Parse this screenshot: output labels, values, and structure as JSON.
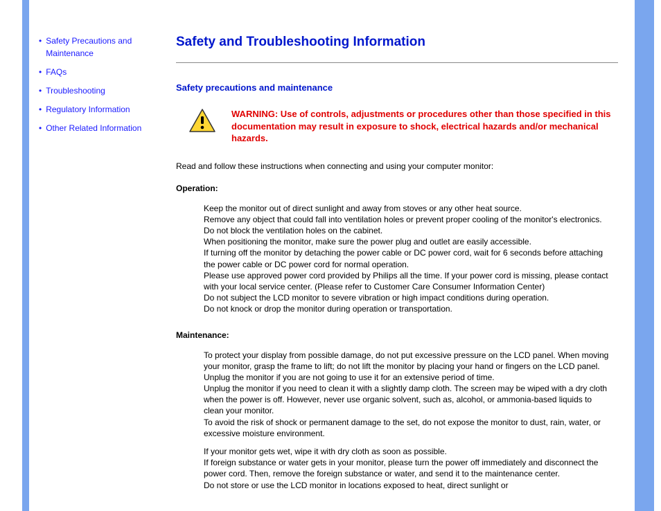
{
  "sidebar": {
    "items": [
      {
        "label": "Safety Precautions and Maintenance"
      },
      {
        "label": "FAQs"
      },
      {
        "label": "Troubleshooting"
      },
      {
        "label": "Regulatory Information"
      },
      {
        "label": "Other Related Information"
      }
    ]
  },
  "main": {
    "title": "Safety and Troubleshooting Information",
    "section_head": "Safety precautions and maintenance",
    "warning": "WARNING: Use of controls, adjustments or procedures other than those specified in this documentation may result in exposure to shock, electrical hazards and/or mechanical hazards.",
    "intro": "Read and follow these instructions when connecting and using your computer monitor:",
    "operation_head": "Operation:",
    "operation_paras": [
      "Keep the monitor out of direct sunlight and away from stoves or any other heat source.",
      "Remove any object that could fall into ventilation holes or prevent proper cooling of the monitor's electronics.",
      "Do not block the ventilation holes on the cabinet.",
      "When positioning the monitor, make sure the power plug and outlet are easily accessible.",
      "If turning off the monitor by detaching the power cable or DC power cord, wait for 6 seconds before attaching the power cable or DC power cord for normal operation.",
      "Please use approved power cord provided by Philips all the time. If your power cord is missing, please contact with your local service center. (Please refer to Customer Care Consumer Information Center)",
      "Do not subject the LCD monitor to severe vibration or high impact conditions during operation.",
      "Do not knock or drop the monitor during operation or transportation."
    ],
    "maintenance_head": "Maintenance:",
    "maintenance_paras": [
      "To protect your display from possible damage, do not put excessive pressure on the LCD panel. When moving your monitor, grasp the frame to lift; do not lift the monitor by placing your hand or fingers on the LCD panel.",
      "Unplug the monitor if you are not going to use it for an extensive period of time.",
      "Unplug the monitor if you need to clean it with a slightly damp cloth. The screen may be wiped with a dry cloth when the power is off. However, never use organic solvent, such as, alcohol, or ammonia-based liquids to clean your monitor.",
      "To avoid the risk of shock or permanent damage to the set, do not expose the monitor to dust, rain, water, or excessive moisture environment."
    ],
    "maintenance_paras2": [
      "If your monitor gets wet, wipe it with dry cloth as soon as possible.",
      "If foreign substance or water gets in your monitor, please turn the power off immediately and disconnect the power cord. Then, remove the foreign substance or water, and send it to the maintenance center.",
      "Do not store or use the LCD monitor in locations exposed to heat, direct sunlight or"
    ]
  }
}
